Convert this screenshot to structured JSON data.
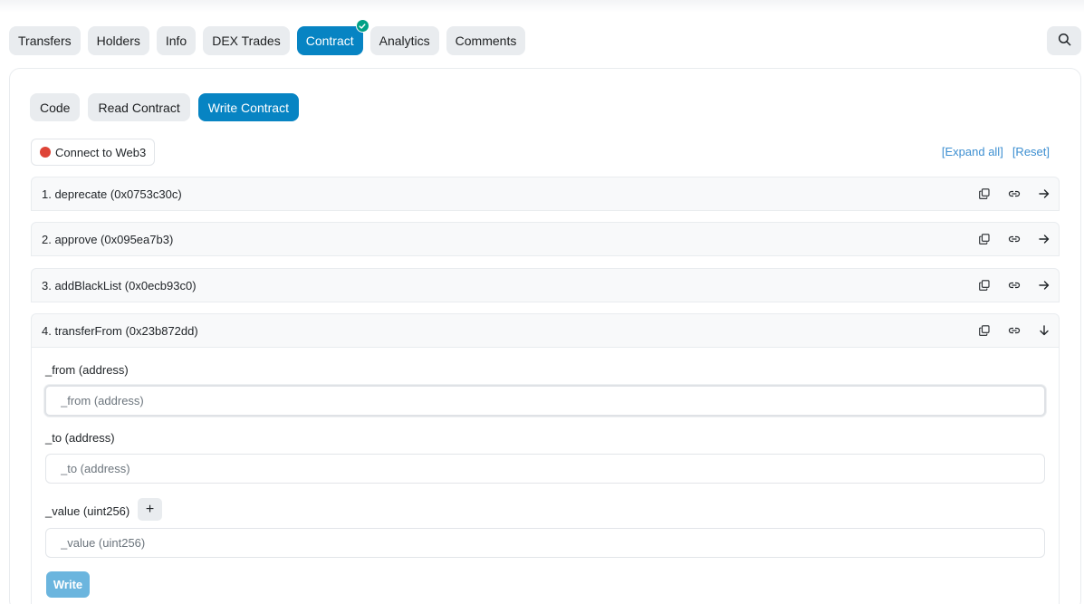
{
  "tabs": [
    {
      "label": "Transfers"
    },
    {
      "label": "Holders"
    },
    {
      "label": "Info"
    },
    {
      "label": "DEX Trades"
    },
    {
      "label": "Contract",
      "active": true,
      "verified": true
    },
    {
      "label": "Analytics"
    },
    {
      "label": "Comments"
    }
  ],
  "subtabs": [
    {
      "label": "Code"
    },
    {
      "label": "Read Contract"
    },
    {
      "label": "Write Contract",
      "active": true
    }
  ],
  "connect": {
    "label": "Connect to Web3",
    "status_color": "#de4437"
  },
  "links": {
    "expand_all": "[Expand all]",
    "reset": "[Reset]"
  },
  "functions": [
    {
      "label": "1. deprecate (0x0753c30c)",
      "expanded": false
    },
    {
      "label": "2. approve (0x095ea7b3)",
      "expanded": false
    },
    {
      "label": "3. addBlackList (0x0ecb93c0)",
      "expanded": false
    },
    {
      "label": "4. transferFrom (0x23b872dd)",
      "expanded": true
    }
  ],
  "form": {
    "from": {
      "label": "_from (address)",
      "placeholder": "_from (address)"
    },
    "to": {
      "label": "_to (address)",
      "placeholder": "_to (address)"
    },
    "value": {
      "label": "_value (uint256)",
      "placeholder": "_value (uint256)",
      "plus": "+"
    },
    "write_label": "Write"
  },
  "colors": {
    "accent": "#0784c3",
    "verified": "#00a186",
    "tab_bg": "#e9ecef"
  }
}
